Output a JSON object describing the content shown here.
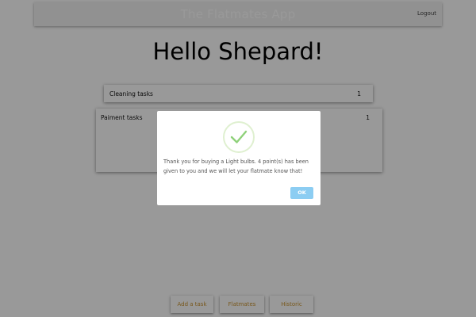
{
  "app": {
    "title": "The Flatmates App",
    "logout_label": "Logout"
  },
  "main": {
    "greeting": "Hello Shepard!",
    "cards": [
      {
        "title": "Cleaning tasks",
        "count": "1"
      },
      {
        "title": "Paiment tasks",
        "count": "1"
      }
    ],
    "bottom_buttons": [
      {
        "label": "Add a task"
      },
      {
        "label": "Flatmates"
      },
      {
        "label": "Historic"
      }
    ]
  },
  "modal": {
    "icon": "success-check-icon",
    "message": "Thank you for buying a Light bulbs. 4 point(s) has been given to you and we will let your flatmate know that!",
    "ok_label": "OK"
  },
  "colors": {
    "accent_button_text": "#c9932f",
    "ok_button": "#8ccdf2",
    "success_check": "#8fd17a",
    "overlay": "rgba(0,0,0,0.4)"
  }
}
